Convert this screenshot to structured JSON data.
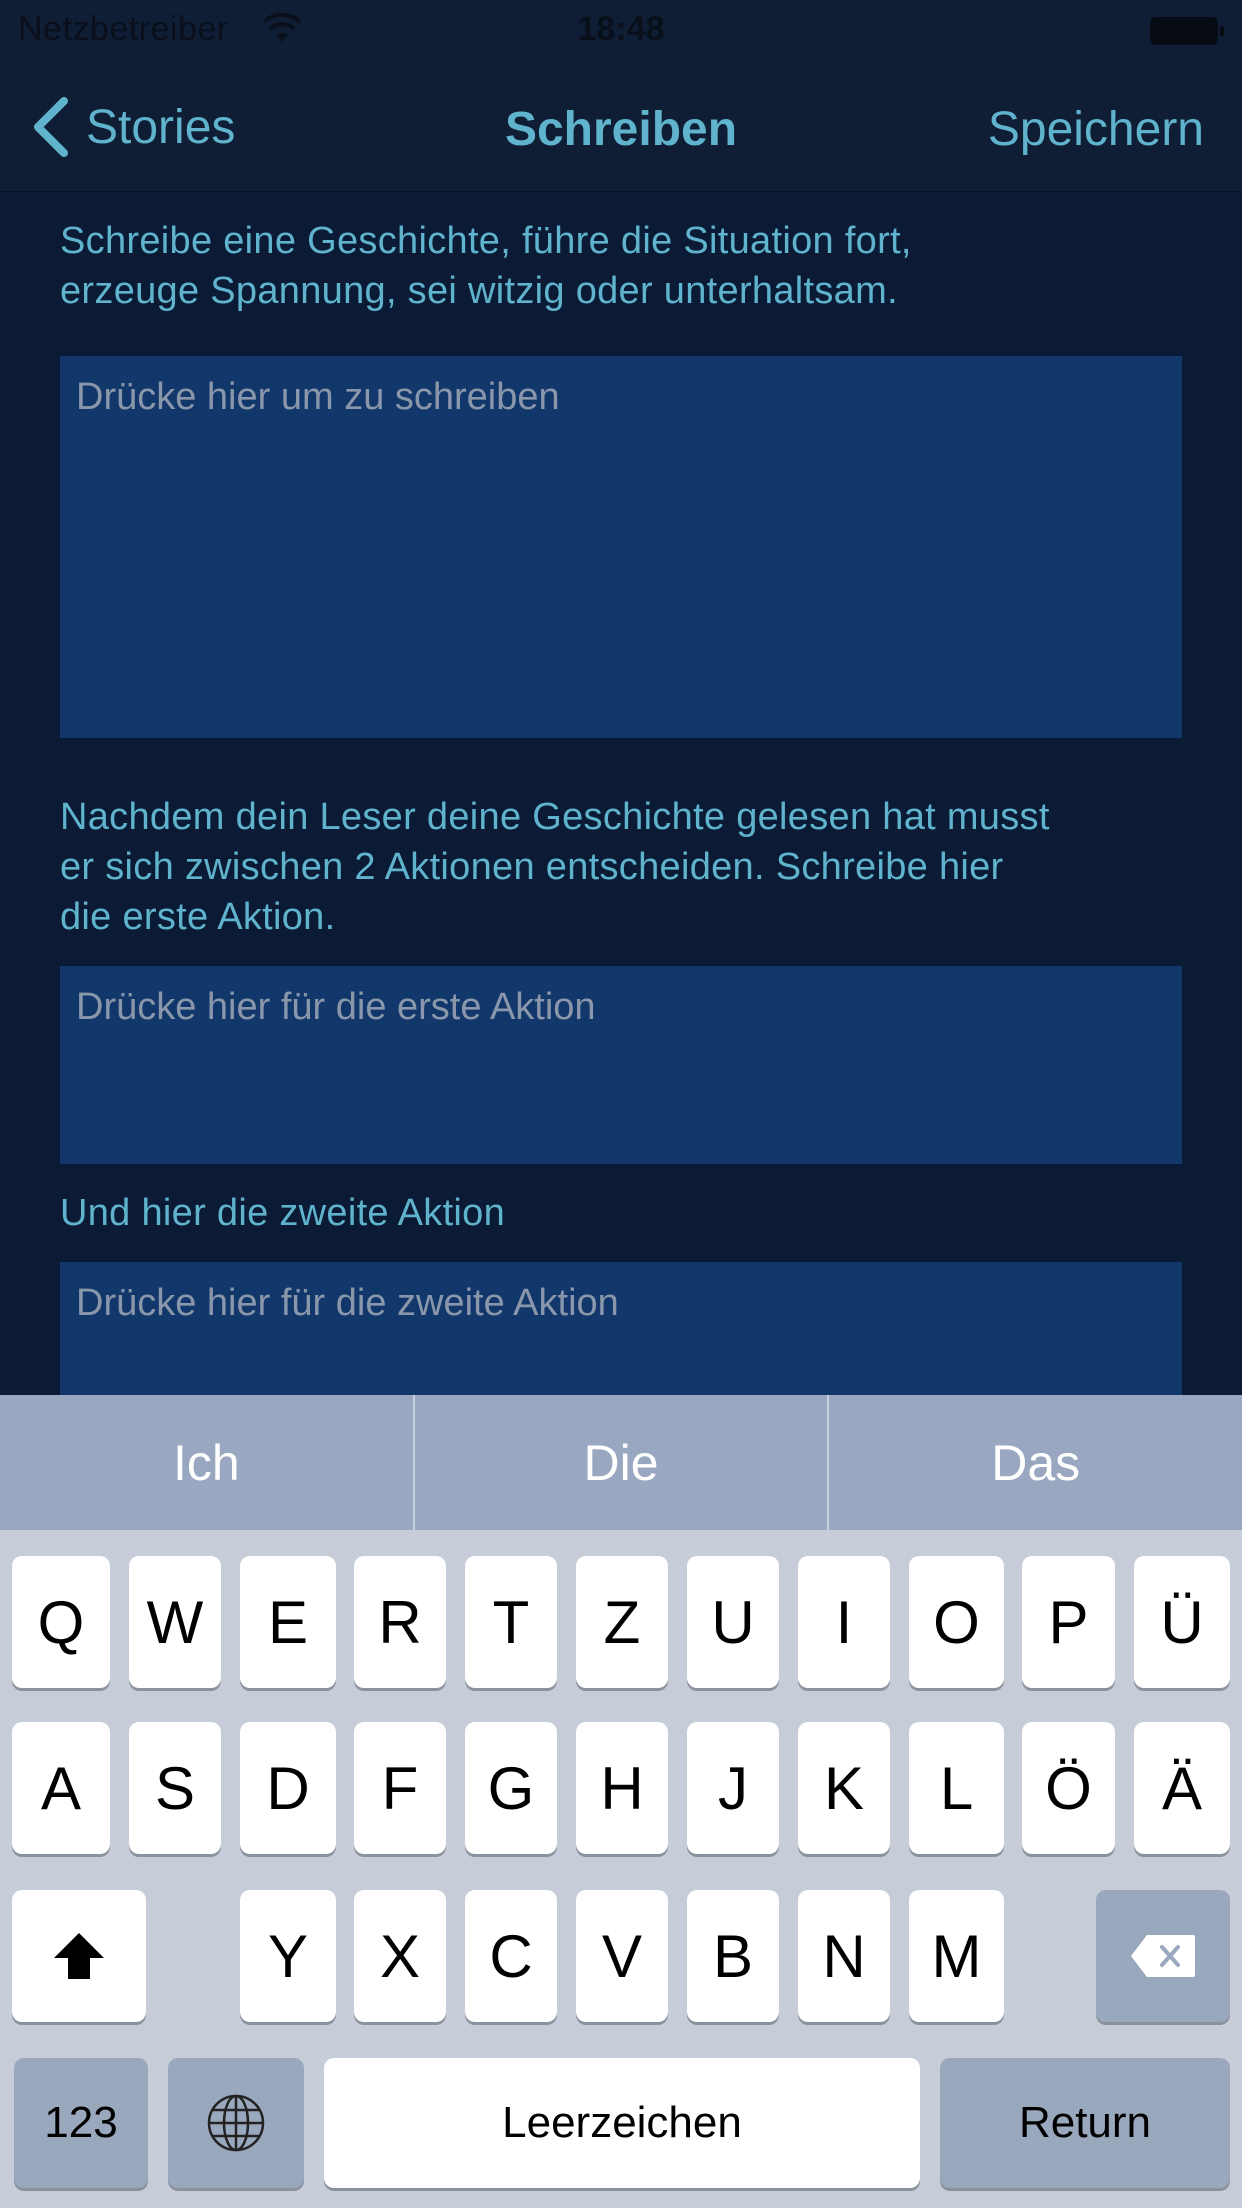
{
  "status": {
    "carrier": "Netzbetreiber",
    "time": "18:48"
  },
  "nav": {
    "back_label": "Stories",
    "title": "Schreiben",
    "save_label": "Speichern"
  },
  "content": {
    "intro_line1": "Schreibe eine Geschichte, führe die Situation fort,",
    "intro_line2": "erzeuge Spannung, sei witzig oder unterhaltsam.",
    "story_placeholder": "Drücke hier um zu schreiben",
    "actions_line1": "Nachdem dein Leser deine Geschichte gelesen hat musst",
    "actions_line2": "er sich zwischen 2 Aktionen entscheiden. Schreibe hier",
    "actions_line3": "die erste Aktion.",
    "action1_placeholder": "Drücke hier für die erste Aktion",
    "action2_label": "Und hier die zweite Aktion",
    "action2_placeholder": "Drücke hier für die zweite Aktion"
  },
  "predictions": [
    "Ich",
    "Die",
    "Das"
  ],
  "keyboard": {
    "row1": [
      "Q",
      "W",
      "E",
      "R",
      "T",
      "Z",
      "U",
      "I",
      "O",
      "P",
      "Ü"
    ],
    "row2": [
      "A",
      "S",
      "D",
      "F",
      "G",
      "H",
      "J",
      "K",
      "L",
      "Ö",
      "Ä"
    ],
    "row3": [
      "Y",
      "X",
      "C",
      "V",
      "B",
      "N",
      "M"
    ],
    "numbers_label": "123",
    "space_label": "Leerzeichen",
    "return_label": "Return"
  },
  "colors": {
    "accent": "#5fb3cc",
    "background": "#0b1a35",
    "field": "#11376b"
  }
}
